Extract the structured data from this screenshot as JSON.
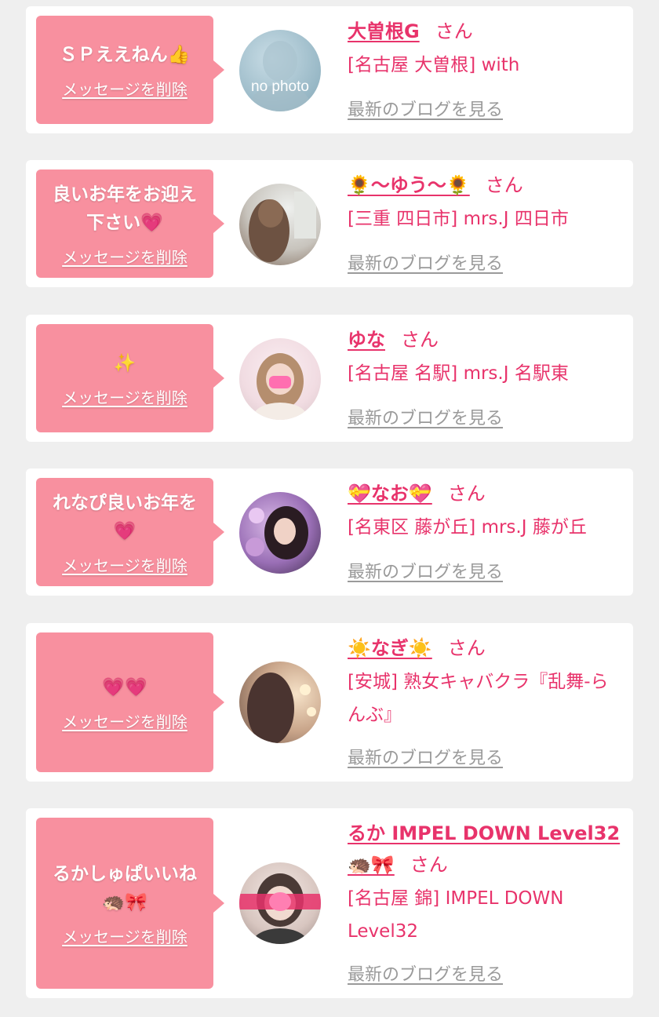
{
  "delete_label": "メッセージを削除",
  "san_label": "さん",
  "blog_label": "最新のブログを見る",
  "colors": {
    "bubble": "#f8909f",
    "name": "#e8336b",
    "link_gray": "#9a9a9a",
    "background": "#efefef"
  },
  "messages": [
    {
      "message": "ＳＰええねん👍",
      "name": "大曽根G",
      "location": "[名古屋 大曽根] with",
      "avatar": "no photo"
    },
    {
      "message": "良いお年をお迎え下さい💗",
      "name": "🌻〜ゆう〜🌻",
      "location": "[三重 四日市] mrs.J 四日市"
    },
    {
      "message": "✨",
      "name": "ゆな",
      "location": "[名古屋 名駅] mrs.J 名駅東"
    },
    {
      "message": "れなぴ良いお年を💗",
      "name": "💝なお💝",
      "location": "[名東区 藤が丘] mrs.J 藤が丘"
    },
    {
      "message": "💗💗",
      "name": "☀️なぎ☀️",
      "location": "[安城] 熟女キャバクラ『乱舞-らんぶ』"
    },
    {
      "message": "るかしゅぱいいね🦔🎀",
      "name": "るか IMPEL DOWN Level32 🦔🎀",
      "location": "[名古屋 錦] IMPEL DOWN Level32"
    }
  ]
}
